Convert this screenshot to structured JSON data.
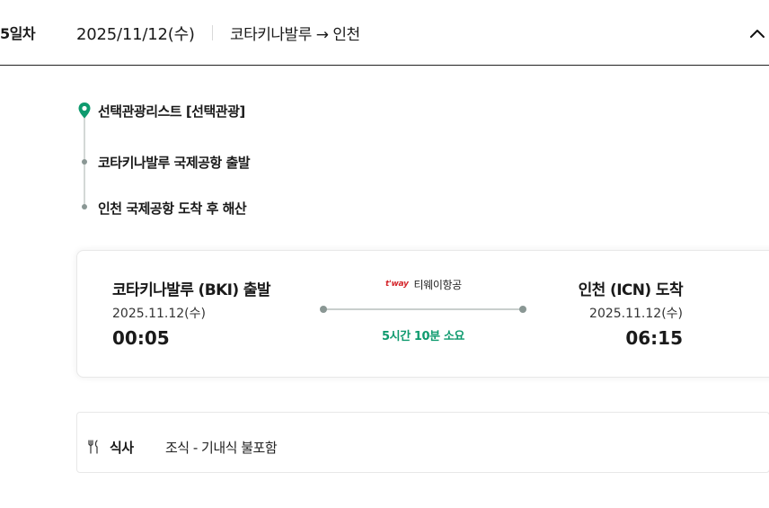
{
  "day": {
    "label": "5일차",
    "date": "2025/11/12(수)",
    "route": "코타키나발루 → 인천"
  },
  "timeline": [
    {
      "text": "선택관광리스트 [선택관광]",
      "icon": "location-pin-icon"
    },
    {
      "text": "코타키나발루 국제공항 출발",
      "icon": "dot-icon"
    },
    {
      "text": "인천 국제공항 도착 후 해산",
      "icon": "dot-icon"
    }
  ],
  "flight": {
    "departure": {
      "city": "코타키나발루 (BKI) 출발",
      "date": "2025.11.12(수)",
      "time": "00:05"
    },
    "arrival": {
      "city": "인천 (ICN) 도착",
      "date": "2025.11.12(수)",
      "time": "06:15"
    },
    "airline": {
      "logo_text": "t'way",
      "name": "티웨이항공"
    },
    "duration": "5시간 10분 소요"
  },
  "meal": {
    "icon": "utensils-icon",
    "label": "식사",
    "value": "조식 - 기내식 불포함"
  },
  "colors": {
    "accent_green": "#0e9a6e",
    "airline_red": "#d4252b",
    "timeline_gray": "#8a9794"
  }
}
